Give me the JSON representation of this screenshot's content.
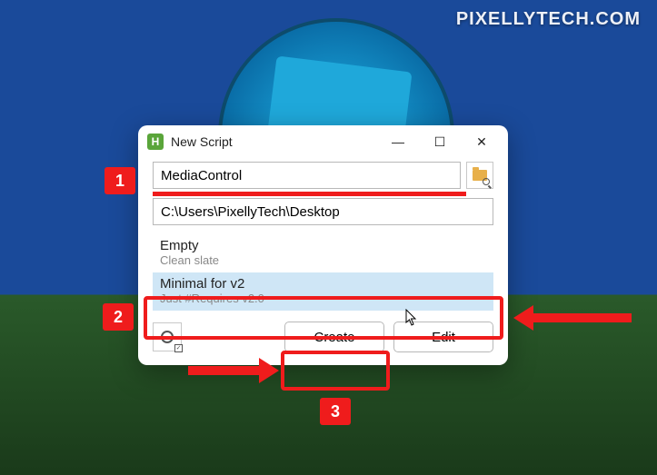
{
  "watermark": "PIXELLYTECH.COM",
  "window": {
    "icon_letter": "H",
    "title": "New Script",
    "name_value": "MediaControl",
    "path_value": "C:\\Users\\PixellyTech\\Desktop",
    "templates": [
      {
        "title": "Empty",
        "subtitle": "Clean slate",
        "selected": false
      },
      {
        "title": "Minimal for v2",
        "subtitle": "Just #Requires v2.0",
        "selected": true
      }
    ],
    "create_label": "Create",
    "edit_label": "Edit"
  },
  "annotations": {
    "badge1": "1",
    "badge2": "2",
    "badge3": "3"
  }
}
